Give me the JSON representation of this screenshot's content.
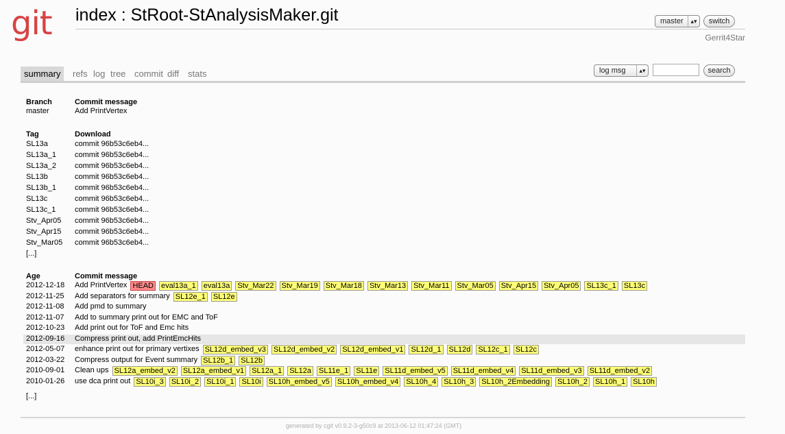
{
  "header": {
    "logo": "git",
    "title": "index : StRoot-StAnalysisMaker.git",
    "branch_select": "master",
    "switch_label": "switch",
    "owner": "Gerrit4Star"
  },
  "tabs": [
    "summary",
    "refs",
    "log",
    "tree",
    "commit",
    "diff",
    "stats"
  ],
  "search": {
    "select_value": "log msg",
    "input_value": "",
    "button_label": "search"
  },
  "branches": {
    "headers": [
      "Branch",
      "Commit message"
    ],
    "rows": [
      {
        "name": "master",
        "message": "Add PrintVertex"
      }
    ]
  },
  "tags": {
    "headers": [
      "Tag",
      "Download"
    ],
    "rows": [
      {
        "name": "SL13a",
        "download": "commit 96b53c6eb4..."
      },
      {
        "name": "SL13a_1",
        "download": "commit 96b53c6eb4..."
      },
      {
        "name": "SL13a_2",
        "download": "commit 96b53c6eb4..."
      },
      {
        "name": "SL13b",
        "download": "commit 96b53c6eb4..."
      },
      {
        "name": "SL13b_1",
        "download": "commit 96b53c6eb4..."
      },
      {
        "name": "SL13c",
        "download": "commit 96b53c6eb4..."
      },
      {
        "name": "SL13c_1",
        "download": "commit 96b53c6eb4..."
      },
      {
        "name": "Stv_Apr05",
        "download": "commit 96b53c6eb4..."
      },
      {
        "name": "Stv_Apr15",
        "download": "commit 96b53c6eb4..."
      },
      {
        "name": "Stv_Mar05",
        "download": "commit 96b53c6eb4..."
      }
    ],
    "more": "[...]"
  },
  "commits": {
    "headers": [
      "Age",
      "Commit message"
    ],
    "rows": [
      {
        "age": "2012-12-18",
        "message": "Add PrintVertex",
        "head": "HEAD",
        "tags": [
          "eval13a_1",
          "eval13a",
          "Stv_Mar22",
          "Stv_Mar19",
          "Stv_Mar18",
          "Stv_Mar13",
          "Stv_Mar11",
          "Stv_Mar05",
          "Stv_Apr15",
          "Stv_Apr05",
          "SL13c_1",
          "SL13c"
        ]
      },
      {
        "age": "2012-11-25",
        "message": "Add separators for summary",
        "head": "",
        "tags": [
          "SL12e_1",
          "SL12e"
        ]
      },
      {
        "age": "2012-11-08",
        "message": "Add pmd to summary",
        "head": "",
        "tags": []
      },
      {
        "age": "2012-11-07",
        "message": "Add to summary print out for EMC and ToF",
        "head": "",
        "tags": []
      },
      {
        "age": "2012-10-23",
        "message": "Add print out for ToF and Emc hits",
        "head": "",
        "tags": []
      },
      {
        "age": "2012-09-16",
        "message": "Compress print out, add PrintEmcHits",
        "head": "",
        "tags": []
      },
      {
        "age": "2012-05-07",
        "message": "enhance print out for primary vertixes",
        "head": "",
        "tags": [
          "SL12d_embed_v3",
          "SL12d_embed_v2",
          "SL12d_embed_v1",
          "SL12d_1",
          "SL12d",
          "SL12c_1",
          "SL12c"
        ]
      },
      {
        "age": "2012-03-22",
        "message": "Compress output for Event summary",
        "head": "",
        "tags": [
          "SL12b_1",
          "SL12b"
        ]
      },
      {
        "age": "2010-09-01",
        "message": "Clean ups",
        "head": "",
        "tags": [
          "SL12a_embed_v2",
          "SL12a_embed_v1",
          "SL12a_1",
          "SL12a",
          "SL11e_1",
          "SL11e",
          "SL11d_embed_v5",
          "SL11d_embed_v4",
          "SL11d_embed_v3",
          "SL11d_embed_v2"
        ]
      },
      {
        "age": "2010-01-26",
        "message": "use dca print out",
        "head": "",
        "tags": [
          "SL10i_3",
          "SL10i_2",
          "SL10i_1",
          "SL10i",
          "SL10h_embed_v5",
          "SL10h_embed_v4",
          "SL10h_4",
          "SL10h_3",
          "SL10h_2Embedding",
          "SL10h_2",
          "SL10h_1",
          "SL10h"
        ]
      }
    ],
    "more": "[...]"
  },
  "footer": "generated by cgit v0.9.2-3-g50c9 at 2013-06-12 01:47:24 (GMT)"
}
